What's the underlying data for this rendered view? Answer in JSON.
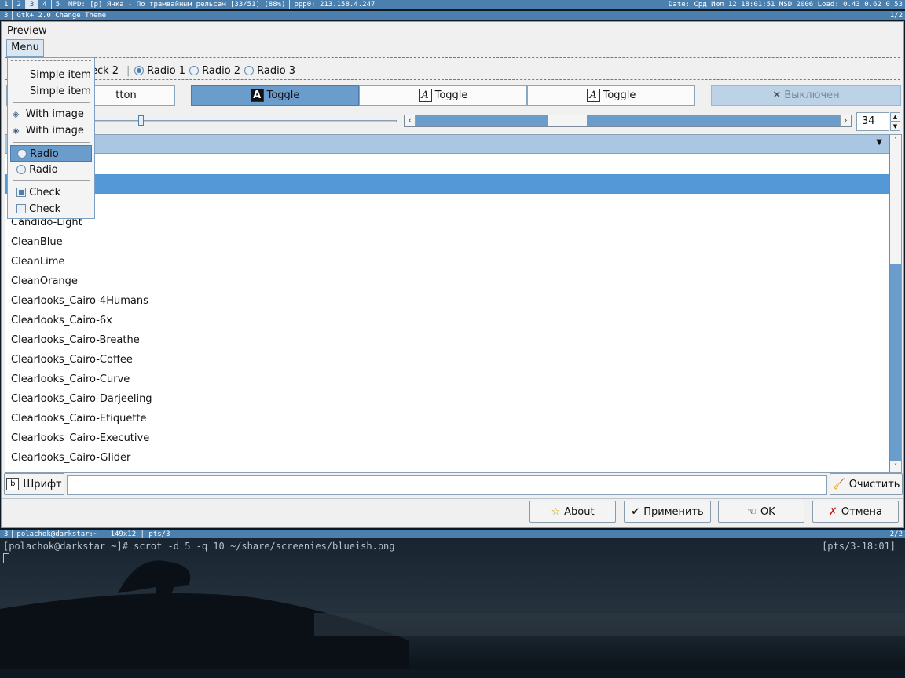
{
  "top_bar": {
    "tags": [
      "1",
      "2",
      "3",
      "4",
      "5"
    ],
    "mpd": "MPD: [p] Янка - По трамвайным рельсам [33/51] (88%)",
    "ppp": "ppp0: 213.158.4.247",
    "status": "Date: Срд Июл 12 18:01:51 MSD 2006 Load: 0.43 0.62 0.53"
  },
  "window1": {
    "tag": "3",
    "title": "Gtk+ 2.0 Change Theme",
    "page": "1/2"
  },
  "preview": {
    "label": "Preview",
    "menu_label": "Menu",
    "check2_label": "eck 2",
    "radio1": "Radio 1",
    "radio2": "Radio 2",
    "radio3": "Radio 3",
    "button_label": "tton",
    "toggle1": "Toggle",
    "toggle2": "Toggle",
    "toggle3": "Toggle",
    "disabled_label": "Выключен",
    "spin_value": "34"
  },
  "menu": {
    "simple1": "Simple item",
    "simple2": "Simple item",
    "image1": "With image",
    "image2": "With image",
    "radio1": "Radio",
    "radio2": "Radio",
    "check1": "Check",
    "check2": "Check"
  },
  "themes": [
    "Candido-Light",
    "CleanBlue",
    "CleanLime",
    "CleanOrange",
    "Clearlooks_Cairo-4Humans",
    "Clearlooks_Cairo-6x",
    "Clearlooks_Cairo-Breathe",
    "Clearlooks_Cairo-Coffee",
    "Clearlooks_Cairo-Curve",
    "Clearlooks_Cairo-Darjeeling",
    "Clearlooks_Cairo-Etiquette",
    "Clearlooks_Cairo-Executive",
    "Clearlooks_Cairo-Glider"
  ],
  "font_row": {
    "font_button": "Шрифт",
    "font_value": "",
    "clear_button": "Очистить"
  },
  "dialog_buttons": {
    "about": "About",
    "apply": "Применить",
    "ok": "OK",
    "cancel": "Отмена"
  },
  "window2": {
    "tag": "3",
    "title": "polachok@darkstar:~ | 149x12 | pts/3",
    "page": "2/2"
  },
  "terminal": {
    "prompt": "[polachok@darkstar ~]# scrot -d 5 -q 10 ~/share/screenies/blueish.png",
    "right": "[pts/3-18:01]"
  },
  "colors": {
    "accent": "#4a7fae",
    "selection": "#5598d8",
    "window_bg": "#f0f0f0"
  }
}
